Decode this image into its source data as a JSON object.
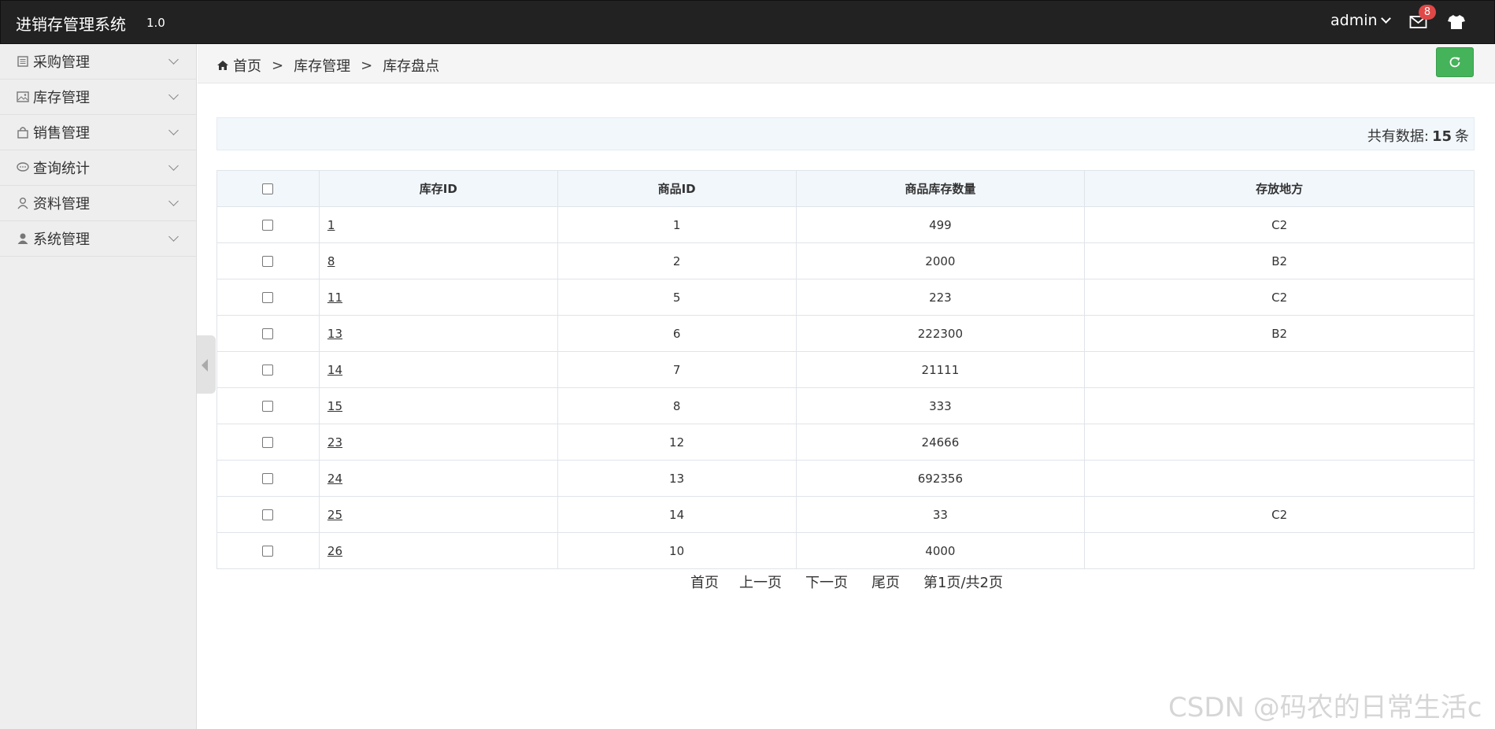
{
  "header": {
    "brand": "进销存管理系统",
    "version": "1.0",
    "user": "admin",
    "mail_badge": "8",
    "icons": {
      "mail": "mail-icon",
      "skin": "tshirt-icon"
    }
  },
  "sidebar": {
    "items": [
      {
        "label": "采购管理",
        "icon": "document-icon"
      },
      {
        "label": "库存管理",
        "icon": "image-icon"
      },
      {
        "label": "销售管理",
        "icon": "bag-icon"
      },
      {
        "label": "查询统计",
        "icon": "chat-icon"
      },
      {
        "label": "资料管理",
        "icon": "user-outline-icon"
      },
      {
        "label": "系统管理",
        "icon": "user-icon"
      }
    ]
  },
  "breadcrumb": {
    "home": "首页",
    "sep": ">",
    "level2": "库存管理",
    "level3": "库存盘点"
  },
  "summary": {
    "prefix": "共有数据:",
    "count": "15",
    "suffix": "条"
  },
  "table": {
    "headers": [
      "库存ID",
      "商品ID",
      "商品库存数量",
      "存放地方"
    ],
    "rows": [
      {
        "id": "1",
        "product_id": "1",
        "qty": "499",
        "location": "C2"
      },
      {
        "id": "8",
        "product_id": "2",
        "qty": "2000",
        "location": "B2"
      },
      {
        "id": "11",
        "product_id": "5",
        "qty": "223",
        "location": "C2"
      },
      {
        "id": "13",
        "product_id": "6",
        "qty": "222300",
        "location": "B2"
      },
      {
        "id": "14",
        "product_id": "7",
        "qty": "21111",
        "location": ""
      },
      {
        "id": "15",
        "product_id": "8",
        "qty": "333",
        "location": ""
      },
      {
        "id": "23",
        "product_id": "12",
        "qty": "24666",
        "location": ""
      },
      {
        "id": "24",
        "product_id": "13",
        "qty": "692356",
        "location": ""
      },
      {
        "id": "25",
        "product_id": "14",
        "qty": "33",
        "location": "C2"
      },
      {
        "id": "26",
        "product_id": "10",
        "qty": "4000",
        "location": ""
      }
    ]
  },
  "pager": {
    "first": "首页",
    "prev": "上一页",
    "next": "下一页",
    "last": "尾页",
    "status": "第1页/共2页"
  },
  "watermark": "CSDN @码农的日常生活c",
  "colors": {
    "topbar": "#222222",
    "sidebar": "#eeeeee",
    "refresh": "#45b35a",
    "badge": "#e04848",
    "table_header": "#f2f7fc"
  }
}
